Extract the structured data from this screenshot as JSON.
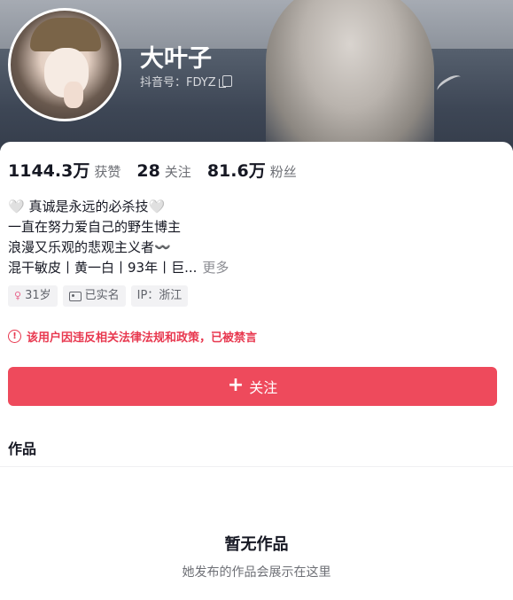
{
  "profile": {
    "name": "大叶子",
    "douyin_id_label": "抖音号：FDYZ"
  },
  "stats": {
    "likes_value": "1144.3万",
    "likes_label": "获赞",
    "following_value": "28",
    "following_label": "关注",
    "followers_value": "81.6万",
    "followers_label": "粉丝"
  },
  "bio": {
    "line1": "🤍 真诚是永远的必杀技🤍",
    "line2": "一直在努力爱自己的野生博主",
    "line3": "浪漫又乐观的悲观主义者〰️",
    "line4": "混干敏皮丨黄一白丨93年丨巨...",
    "more_label": "更多"
  },
  "tags": {
    "age": "31岁",
    "verified": "已实名",
    "ip": "IP：浙江"
  },
  "warning": {
    "text": "该用户因违反相关法律法规和政策，已被禁言",
    "icon": "exclamation-circle-icon",
    "color": "#e8384f"
  },
  "follow_button": {
    "label": "关注",
    "color": "#ee4a5c"
  },
  "works": {
    "title": "作品",
    "empty_title": "暂无作品",
    "empty_subtitle": "她发布的作品会展示在这里"
  }
}
